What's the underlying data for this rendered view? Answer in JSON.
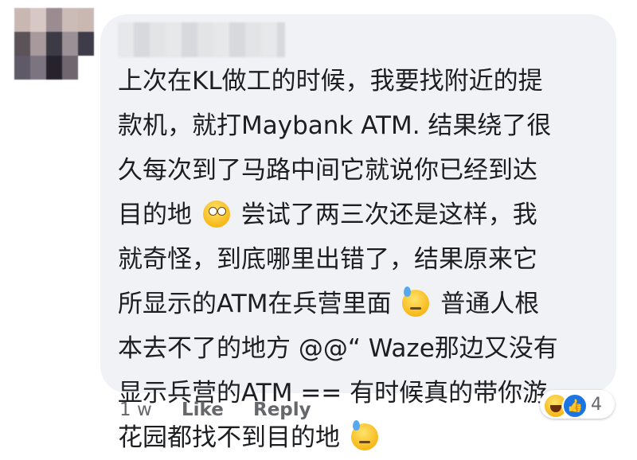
{
  "comment": {
    "lines": [
      "上次在KL做工的时候，我要找附近的提",
      "款机，就打Maybank ATM. 结果绕了很",
      "久每次到了马路中间它就说你已经到达",
      [
        "目的地",
        "尝试了两三次还是这样，我"
      ],
      "就奇怪，到底哪里出错了，结果原来它",
      [
        "所显示的ATM在兵营里面",
        "普通人根"
      ],
      "本去不了的地方 @@“ Waze那边又没有",
      "显示兵营的ATM == 有时候真的带你游",
      [
        "花园都找不到目的地",
        ""
      ]
    ],
    "emojis": [
      "face-with-rolling-eyes-icon",
      "downcast-sweat-face-icon",
      "downcast-sweat-face-icon"
    ]
  },
  "reactions": {
    "count": "4",
    "icons": [
      "haha-reaction-icon",
      "like-reaction-icon"
    ],
    "like_color": "#1b74e4"
  },
  "actions": {
    "time": "1 w",
    "like": "Like",
    "reply": "Reply"
  },
  "colors": {
    "bubble": "#f0f2f5",
    "text": "#1c1e21",
    "meta": "#65676b"
  }
}
